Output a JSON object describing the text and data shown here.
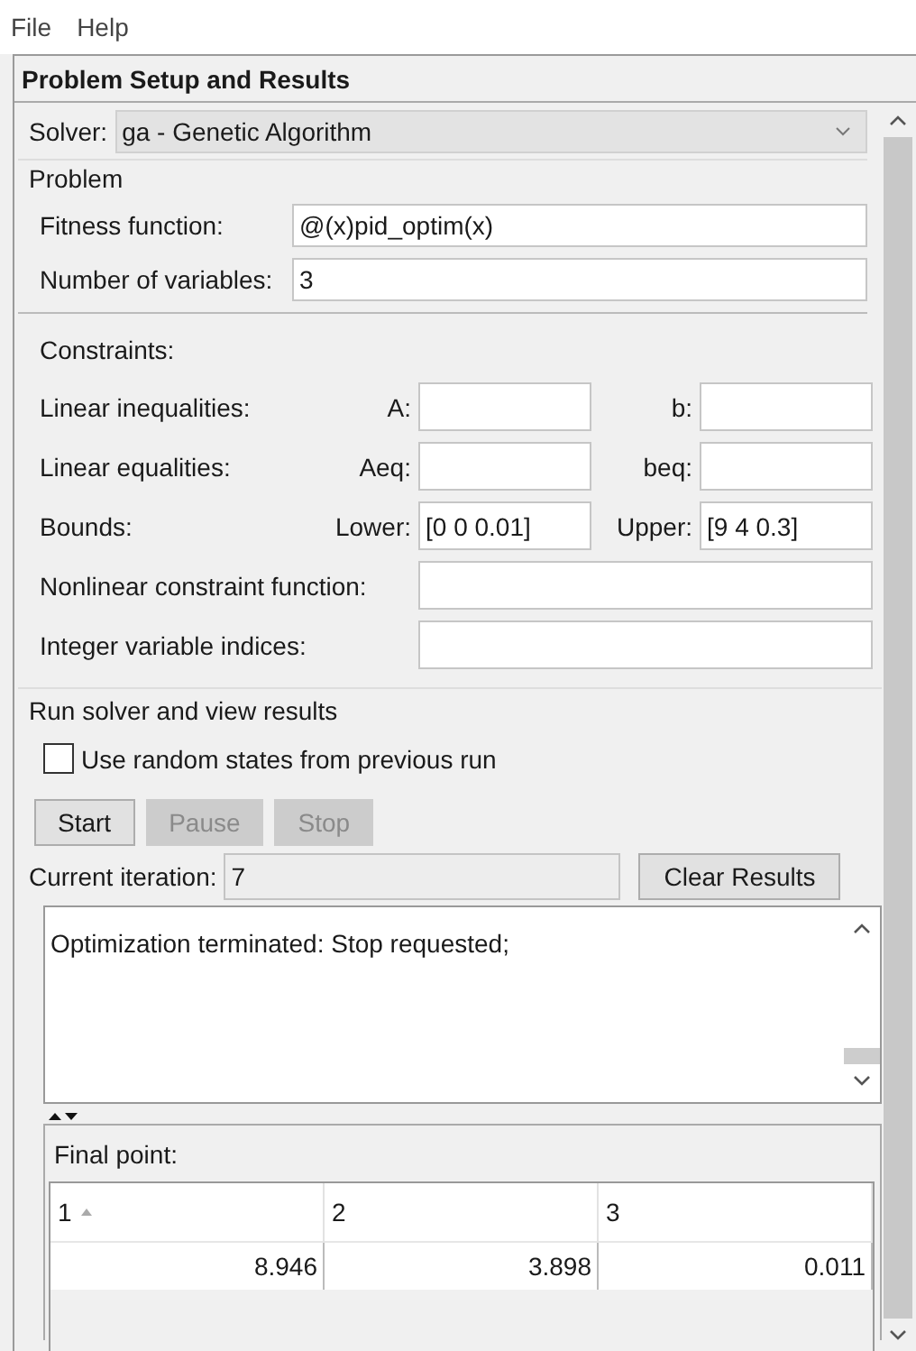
{
  "menu": [
    "File",
    "Help"
  ],
  "panel_title": "Problem Setup and Results",
  "solver": {
    "label": "Solver:",
    "value": "ga - Genetic Algorithm"
  },
  "problem": {
    "title": "Problem",
    "fields": [
      {
        "label": "Fitness function:",
        "value": "@(x)pid_optim(x)"
      },
      {
        "label": "Number of variables:",
        "value": "3"
      }
    ]
  },
  "constraints": {
    "title": "Constraints:",
    "rows": [
      {
        "kind": "pair",
        "label": "Linear inequalities:",
        "fields": [
          {
            "label": "A:"
          },
          {
            "label": "b:"
          }
        ]
      },
      {
        "kind": "pair",
        "label": "Linear equalities:",
        "fields": [
          {
            "label": "Aeq:"
          },
          {
            "label": "beq:"
          }
        ]
      },
      {
        "kind": "pair",
        "label": "Bounds:",
        "fields": [
          {
            "label": "Lower:",
            "value": "[0 0 0.01]"
          },
          {
            "label": "Upper:",
            "value": "[9 4 0.3]"
          }
        ]
      },
      {
        "kind": "single",
        "label": "Nonlinear constraint function:"
      },
      {
        "kind": "single",
        "label": "Integer variable indices:"
      }
    ]
  },
  "run": {
    "title": "Run solver and view results",
    "checkbox": {
      "label": "Use random states from previous run",
      "checked": false
    },
    "buttons": [
      {
        "label": "Start",
        "disabled": false
      },
      {
        "label": "Pause",
        "disabled": true
      },
      {
        "label": "Stop",
        "disabled": true
      }
    ],
    "iteration": {
      "label": "Current iteration:",
      "value": "7"
    },
    "clear_button": "Clear Results"
  },
  "output": {
    "lines": [
      "Optimization terminated: Stop requested;"
    ]
  },
  "final_point": {
    "title": "Final point:",
    "columns": [
      {
        "label": "1",
        "sorted": true
      },
      {
        "label": "2",
        "sorted": false
      },
      {
        "label": "3",
        "sorted": false
      }
    ],
    "rows": [
      [
        "8.946",
        "3.898",
        "0.011"
      ]
    ]
  }
}
